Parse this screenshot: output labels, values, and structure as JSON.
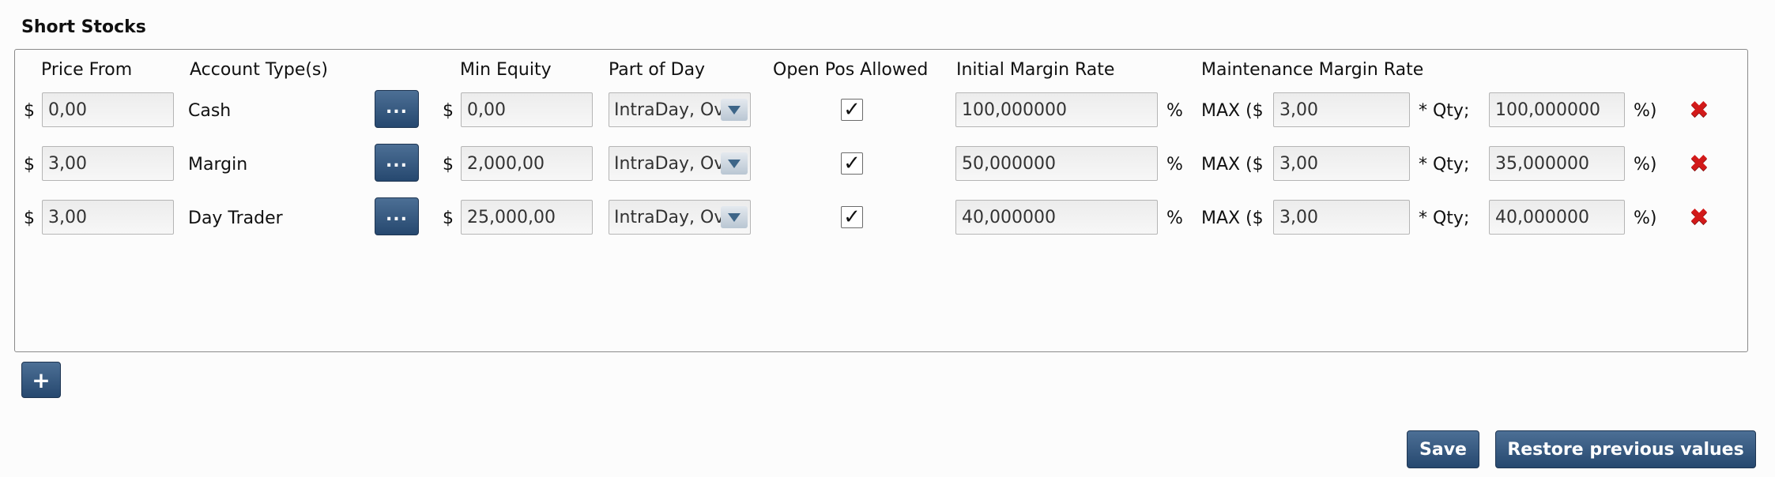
{
  "section": {
    "title": "Short Stocks"
  },
  "headers": {
    "price_from": "Price From",
    "account_types": "Account Type(s)",
    "min_equity": "Min Equity",
    "part_of_day": "Part of Day",
    "open_pos_allowed": "Open Pos Allowed",
    "initial_margin_rate": "Initial Margin Rate",
    "maintenance_margin_rate": "Maintenance Margin Rate"
  },
  "symbols": {
    "dollar": "$",
    "percent": "%",
    "max_open": "MAX ($",
    "qty": "* Qty;",
    "pct_close": "%)",
    "dots": "...",
    "check": "✓",
    "delete": "✖",
    "add": "+"
  },
  "rows": [
    {
      "price_from": "0,00",
      "account_type": "Cash",
      "min_equity": "0,00",
      "part_of_day": "IntraDay, Overnight",
      "open_pos_allowed": true,
      "initial_margin_rate": "100,000000",
      "maint_base": "3,00",
      "maint_rate": "100,000000"
    },
    {
      "price_from": "3,00",
      "account_type": "Margin",
      "min_equity": "2,000,00",
      "part_of_day": "IntraDay, Overnight",
      "open_pos_allowed": true,
      "initial_margin_rate": "50,000000",
      "maint_base": "3,00",
      "maint_rate": "35,000000"
    },
    {
      "price_from": "3,00",
      "account_type": "Day Trader",
      "min_equity": "25,000,00",
      "part_of_day": "IntraDay, Overnight",
      "open_pos_allowed": true,
      "initial_margin_rate": "40,000000",
      "maint_base": "3,00",
      "maint_rate": "40,000000"
    }
  ],
  "buttons": {
    "save": "Save",
    "restore": "Restore previous values"
  }
}
